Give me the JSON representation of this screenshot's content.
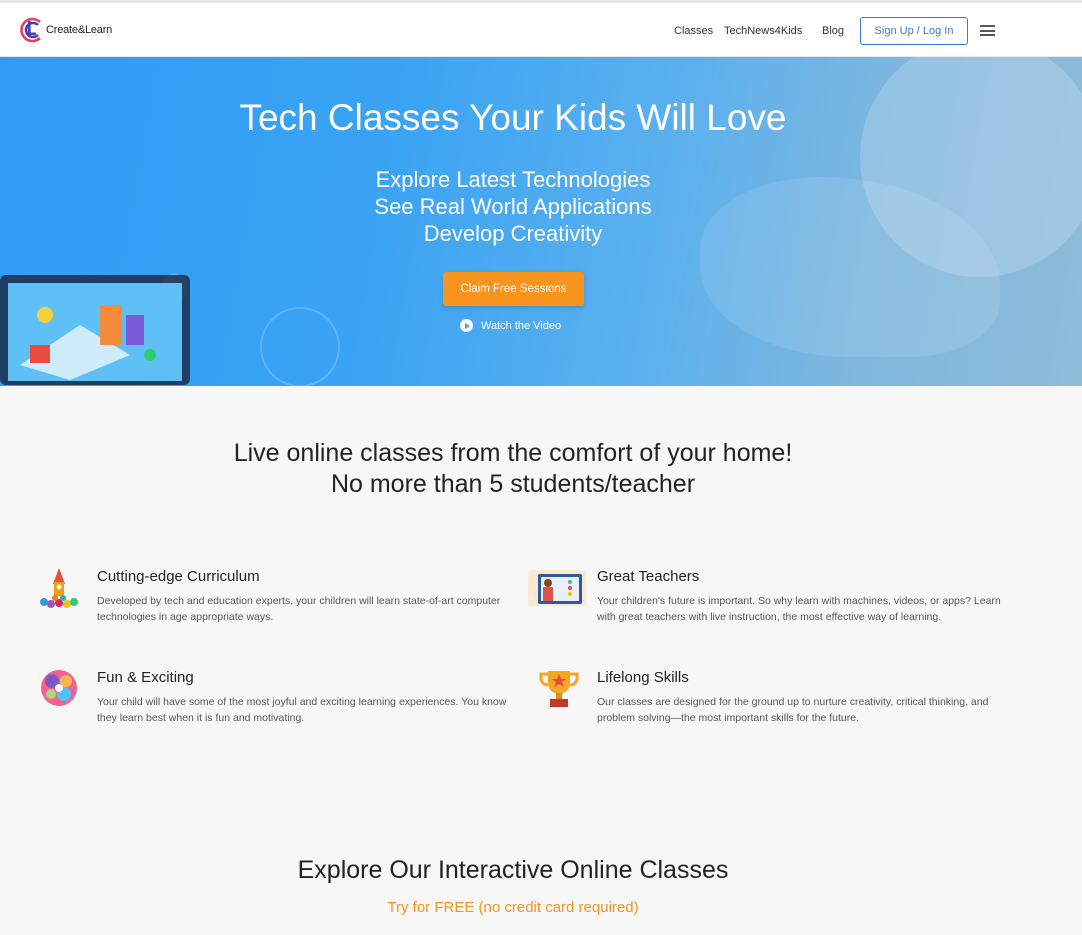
{
  "header": {
    "logo_text": "Create&Learn",
    "nav": [
      "Classes",
      "TechNews4Kids",
      "Blog"
    ],
    "signup_label": "Sign Up / Log In"
  },
  "hero": {
    "title": "Tech Classes Your Kids Will Love",
    "lines": [
      "Explore Latest Technologies",
      "See Real World Applications",
      "Develop Creativity"
    ],
    "cta_label": "Claim Free Sessions",
    "video_label": "Watch the Video"
  },
  "intro": {
    "line1": "Live online classes from the comfort of your home!",
    "line2": "No more than 5 students/teacher"
  },
  "features": [
    {
      "icon": "rocket-icon",
      "title": "Cutting-edge Curriculum",
      "desc": "Developed by tech and education experts, your children will learn state-of-art computer technologies in age appropriate ways."
    },
    {
      "icon": "teacher-icon",
      "title": "Great Teachers",
      "desc": "Your children's future is important. So why learn with machines, videos, or apps? Learn with great teachers with live instruction, the most effective way of learning."
    },
    {
      "icon": "palette-icon",
      "title": "Fun & Exciting",
      "desc": "Your child will have some of the most joyful and exciting learning experiences. You know they learn best when it is fun and motivating."
    },
    {
      "icon": "trophy-icon",
      "title": "Lifelong Skills",
      "desc": "Our classes are designed for the ground up to nurture creativity, critical thinking, and problem solving—the most important skills for the future."
    }
  ],
  "explore": {
    "title": "Explore Our Interactive Online Classes",
    "subtitle": "Try for FREE (no credit card required)"
  },
  "colors": {
    "accent": "#f7941d",
    "brand_blue": "#3a7bd5",
    "hero_blue": "#2f9cf3"
  }
}
